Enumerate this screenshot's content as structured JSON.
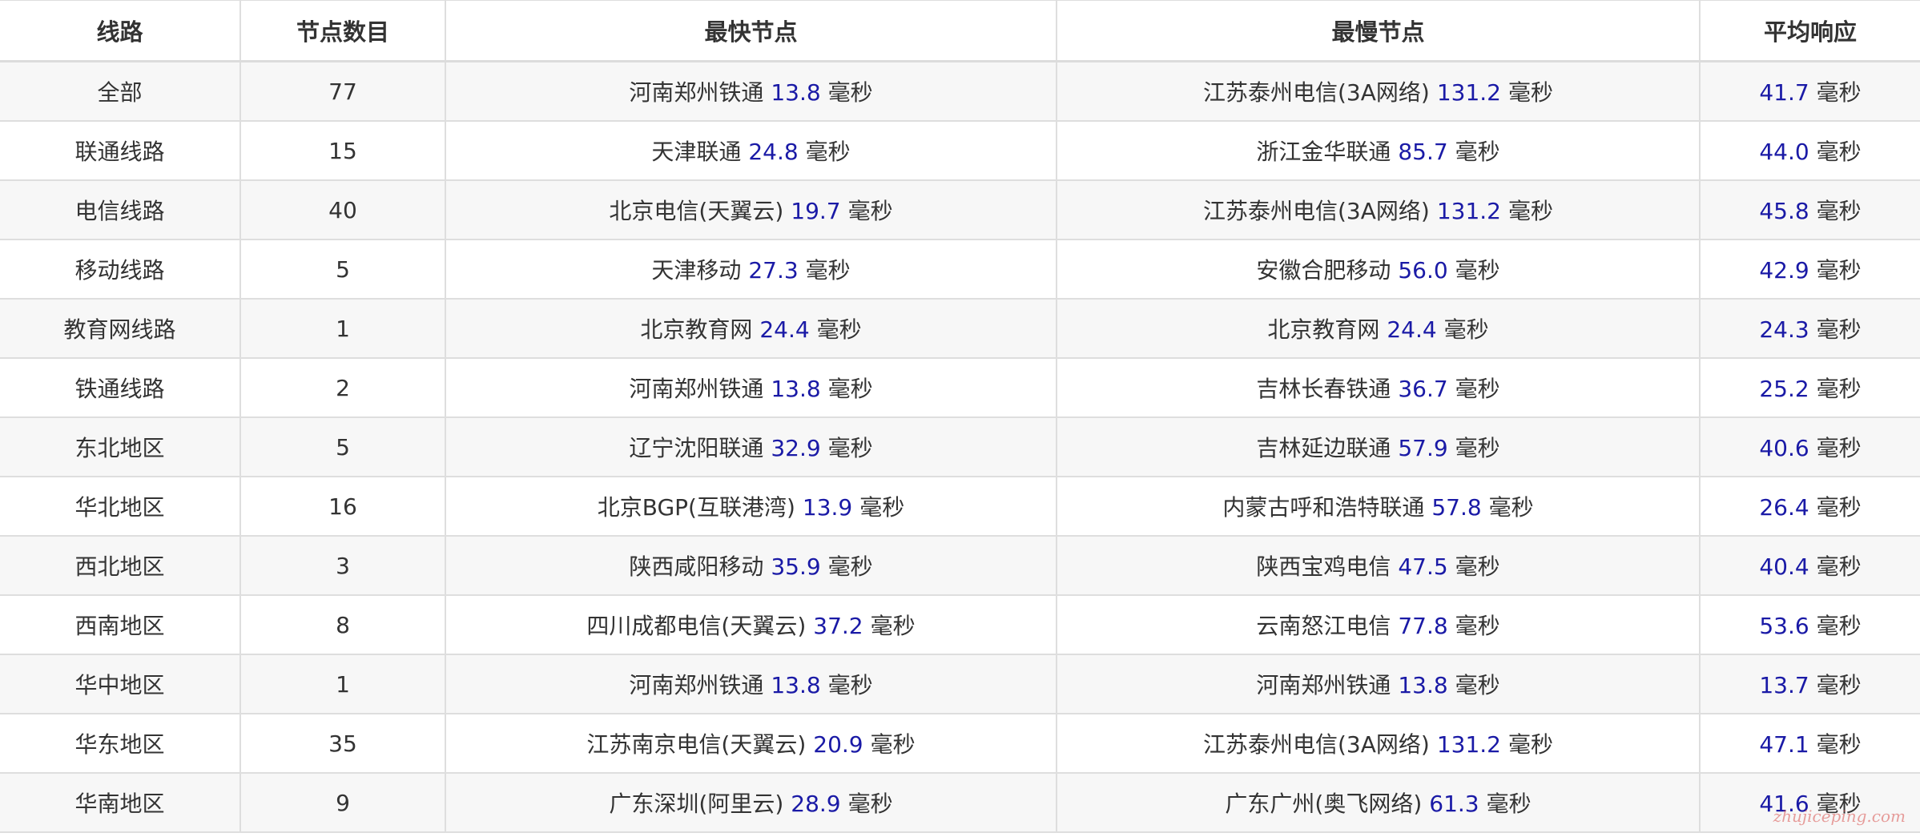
{
  "table": {
    "headers": [
      "线路",
      "节点数目",
      "最快节点",
      "最慢节点",
      "平均响应"
    ],
    "unit": "毫秒",
    "rows": [
      {
        "route": "全部",
        "count": "77",
        "fastest": {
          "node": "河南郑州铁通",
          "ms": "13.8"
        },
        "slowest": {
          "node": "江苏泰州电信(3A网络)",
          "ms": "131.2"
        },
        "avg": "41.7"
      },
      {
        "route": "联通线路",
        "count": "15",
        "fastest": {
          "node": "天津联通",
          "ms": "24.8"
        },
        "slowest": {
          "node": "浙江金华联通",
          "ms": "85.7"
        },
        "avg": "44.0"
      },
      {
        "route": "电信线路",
        "count": "40",
        "fastest": {
          "node": "北京电信(天翼云)",
          "ms": "19.7"
        },
        "slowest": {
          "node": "江苏泰州电信(3A网络)",
          "ms": "131.2"
        },
        "avg": "45.8"
      },
      {
        "route": "移动线路",
        "count": "5",
        "fastest": {
          "node": "天津移动",
          "ms": "27.3"
        },
        "slowest": {
          "node": "安徽合肥移动",
          "ms": "56.0"
        },
        "avg": "42.9"
      },
      {
        "route": "教育网线路",
        "count": "1",
        "fastest": {
          "node": "北京教育网",
          "ms": "24.4"
        },
        "slowest": {
          "node": "北京教育网",
          "ms": "24.4"
        },
        "avg": "24.3"
      },
      {
        "route": "铁通线路",
        "count": "2",
        "fastest": {
          "node": "河南郑州铁通",
          "ms": "13.8"
        },
        "slowest": {
          "node": "吉林长春铁通",
          "ms": "36.7"
        },
        "avg": "25.2"
      },
      {
        "route": "东北地区",
        "count": "5",
        "fastest": {
          "node": "辽宁沈阳联通",
          "ms": "32.9"
        },
        "slowest": {
          "node": "吉林延边联通",
          "ms": "57.9"
        },
        "avg": "40.6"
      },
      {
        "route": "华北地区",
        "count": "16",
        "fastest": {
          "node": "北京BGP(互联港湾)",
          "ms": "13.9"
        },
        "slowest": {
          "node": "内蒙古呼和浩特联通",
          "ms": "57.8"
        },
        "avg": "26.4"
      },
      {
        "route": "西北地区",
        "count": "3",
        "fastest": {
          "node": "陕西咸阳移动",
          "ms": "35.9"
        },
        "slowest": {
          "node": "陕西宝鸡电信",
          "ms": "47.5"
        },
        "avg": "40.4"
      },
      {
        "route": "西南地区",
        "count": "8",
        "fastest": {
          "node": "四川成都电信(天翼云)",
          "ms": "37.2"
        },
        "slowest": {
          "node": "云南怒江电信",
          "ms": "77.8"
        },
        "avg": "53.6"
      },
      {
        "route": "华中地区",
        "count": "1",
        "fastest": {
          "node": "河南郑州铁通",
          "ms": "13.8"
        },
        "slowest": {
          "node": "河南郑州铁通",
          "ms": "13.8"
        },
        "avg": "13.7"
      },
      {
        "route": "华东地区",
        "count": "35",
        "fastest": {
          "node": "江苏南京电信(天翼云)",
          "ms": "20.9"
        },
        "slowest": {
          "node": "江苏泰州电信(3A网络)",
          "ms": "131.2"
        },
        "avg": "47.1"
      },
      {
        "route": "华南地区",
        "count": "9",
        "fastest": {
          "node": "广东深圳(阿里云)",
          "ms": "28.9"
        },
        "slowest": {
          "node": "广东广州(奥飞网络)",
          "ms": "61.3"
        },
        "avg": "41.6"
      }
    ]
  },
  "watermark": {
    "text": "zhujiceping.com"
  }
}
